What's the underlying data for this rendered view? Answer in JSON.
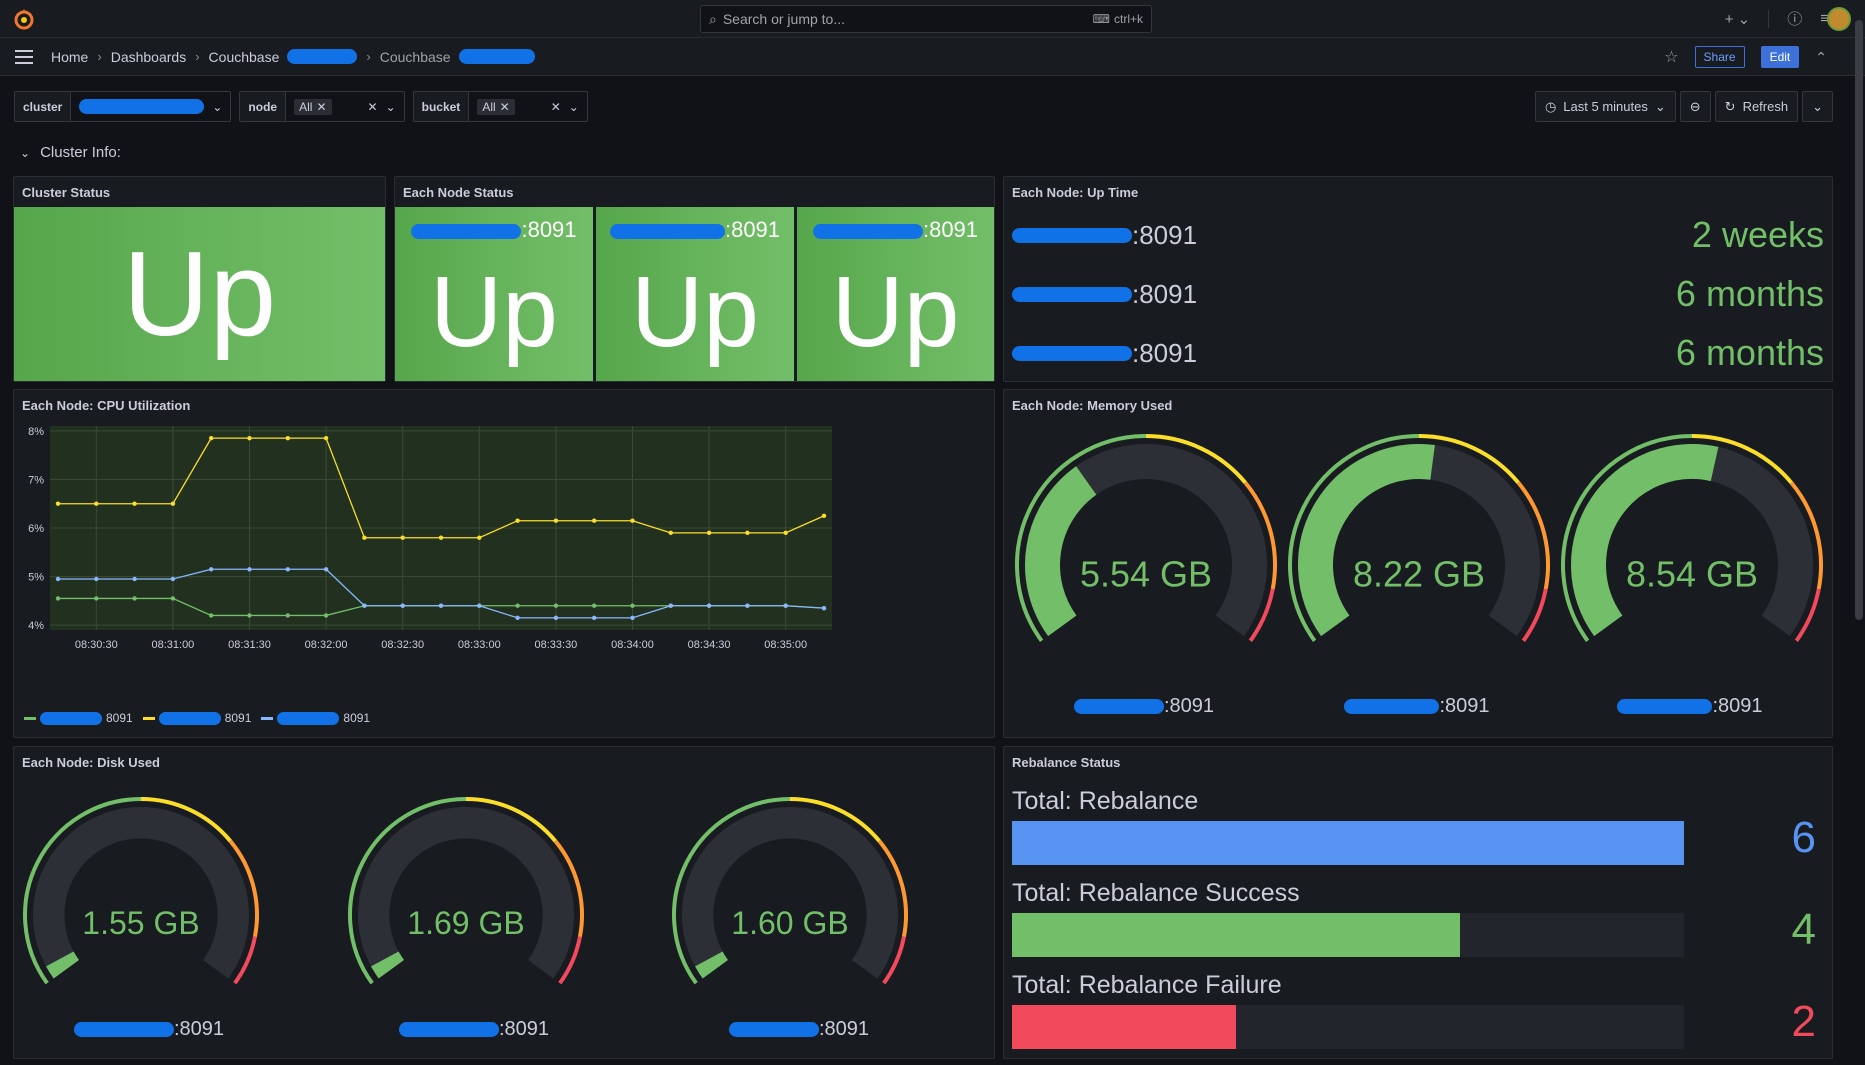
{
  "app": {
    "search_placeholder": "Search or jump to...",
    "search_shortcut": "ctrl+k"
  },
  "breadcrumb": {
    "home": "Home",
    "dashboards": "Dashboards",
    "folder": "Couchbase",
    "dashboard": "Couchbase"
  },
  "actions": {
    "share": "Share",
    "edit": "Edit"
  },
  "filters": [
    {
      "label": "cluster",
      "value": ""
    },
    {
      "label": "node",
      "value": "All"
    },
    {
      "label": "bucket",
      "value": "All"
    }
  ],
  "time": {
    "range": "Last 5 minutes",
    "refresh": "Refresh"
  },
  "row": {
    "title": "Cluster Info:"
  },
  "cluster_status": {
    "title": "Cluster Status",
    "value": "Up"
  },
  "node_status": {
    "title": "Each Node Status",
    "nodes": [
      {
        "port": ":8091",
        "value": "Up"
      },
      {
        "port": ":8091",
        "value": "Up"
      },
      {
        "port": ":8091",
        "value": "Up"
      }
    ]
  },
  "uptime": {
    "title": "Each Node: Up Time",
    "rows": [
      {
        "port": ":8091",
        "value": "2 weeks"
      },
      {
        "port": ":8091",
        "value": "6 months"
      },
      {
        "port": ":8091",
        "value": "6 months"
      }
    ]
  },
  "cpu": {
    "title": "Each Node: CPU Utilization"
  },
  "memory": {
    "title": "Each Node: Memory Used",
    "gauges": [
      {
        "value": "5.54 GB",
        "fraction": 0.36,
        "port": ":8091"
      },
      {
        "value": "8.22 GB",
        "fraction": 0.53,
        "port": ":8091"
      },
      {
        "value": "8.54 GB",
        "fraction": 0.55,
        "port": ":8091"
      }
    ]
  },
  "disk": {
    "title": "Each Node: Disk Used",
    "gauges": [
      {
        "value": "1.55 GB",
        "fraction": 0.03,
        "port": ":8091"
      },
      {
        "value": "1.69 GB",
        "fraction": 0.03,
        "port": ":8091"
      },
      {
        "value": "1.60 GB",
        "fraction": 0.03,
        "port": ":8091"
      }
    ]
  },
  "rebalance": {
    "title": "Rebalance Status",
    "bars": [
      {
        "label": "Total: Rebalance",
        "value": "6",
        "fraction": 1.0,
        "color": "#5794f2"
      },
      {
        "label": "Total: Rebalance Success",
        "value": "4",
        "fraction": 0.667,
        "color": "#73bf69"
      },
      {
        "label": "Total: Rebalance Failure",
        "value": "2",
        "fraction": 0.333,
        "color": "#f2495c"
      }
    ]
  },
  "colors": {
    "green": "#73bf69",
    "yellow": "#fade2a",
    "blue": "#8ab8ff",
    "red": "#f2495c",
    "orange": "#ff9830"
  },
  "chart_data": {
    "type": "line",
    "title": "Each Node: CPU Utilization",
    "x": [
      "08:30:15",
      "08:30:30",
      "08:30:45",
      "08:31:00",
      "08:31:15",
      "08:31:30",
      "08:31:45",
      "08:32:00",
      "08:32:15",
      "08:32:30",
      "08:32:45",
      "08:33:00",
      "08:33:15",
      "08:33:30",
      "08:33:45",
      "08:34:00",
      "08:34:15",
      "08:34:30",
      "08:34:45",
      "08:35:00",
      "08:35:15"
    ],
    "xticks": [
      "08:30:30",
      "08:31:00",
      "08:31:30",
      "08:32:00",
      "08:32:30",
      "08:33:00",
      "08:33:30",
      "08:34:00",
      "08:34:30",
      "08:35:00"
    ],
    "yticks": [
      "4%",
      "5%",
      "6%",
      "7%",
      "8%"
    ],
    "ylim": [
      3.9,
      8.1
    ],
    "grid": true,
    "legend": "bottom-left",
    "series": [
      {
        "port": "8091",
        "color": "#73bf69",
        "values": [
          4.55,
          4.55,
          4.55,
          4.55,
          4.2,
          4.2,
          4.2,
          4.2,
          4.4,
          4.4,
          4.4,
          4.4,
          4.4,
          4.4,
          4.4,
          4.4,
          4.4,
          4.4,
          4.4,
          4.4,
          4.35
        ]
      },
      {
        "port": "8091",
        "color": "#fade2a",
        "values": [
          6.5,
          6.5,
          6.5,
          6.5,
          7.85,
          7.85,
          7.85,
          7.85,
          5.8,
          5.8,
          5.8,
          5.8,
          6.15,
          6.15,
          6.15,
          6.15,
          5.9,
          5.9,
          5.9,
          5.9,
          6.25
        ]
      },
      {
        "port": "8091",
        "color": "#8ab8ff",
        "values": [
          4.95,
          4.95,
          4.95,
          4.95,
          5.15,
          5.15,
          5.15,
          5.15,
          4.4,
          4.4,
          4.4,
          4.4,
          4.15,
          4.15,
          4.15,
          4.15,
          4.4,
          4.4,
          4.4,
          4.4,
          4.35
        ]
      }
    ]
  }
}
